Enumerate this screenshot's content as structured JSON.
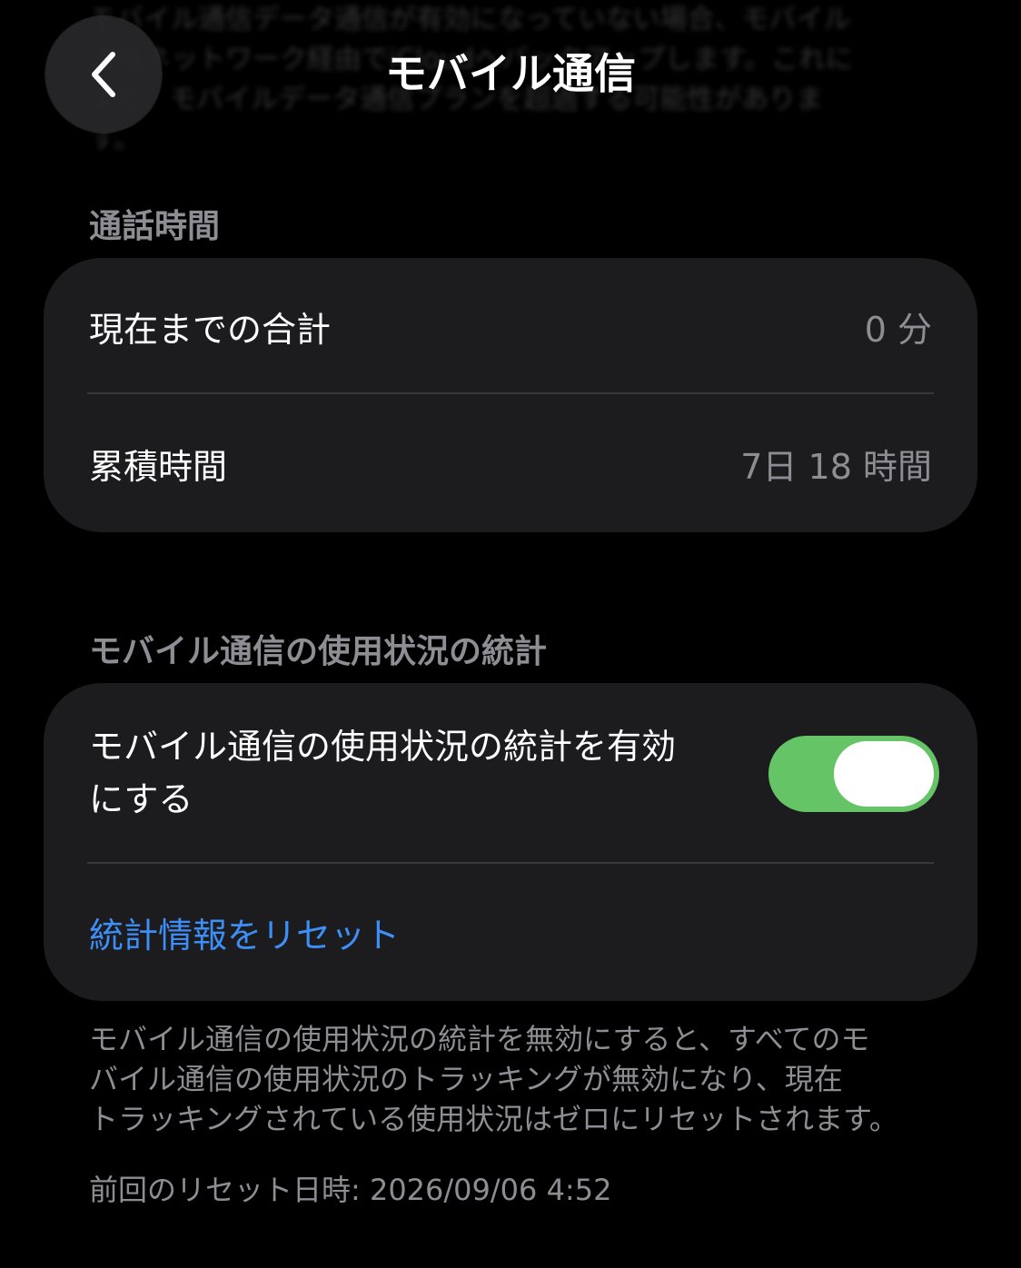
{
  "background_text": "モバイル通信データ通信が有効になっていない場合、モバイル通信ネットワーク経由でiCloudへバックアップします。これにより、モバイルデータ通信プランを超過する可能性があります。",
  "nav": {
    "title": "モバイル通信",
    "back_icon": "chevron-left-icon"
  },
  "call_time": {
    "header": "通話時間",
    "rows": [
      {
        "label": "現在までの合計",
        "value": "0 分"
      },
      {
        "label": "累積時間",
        "value": "7日 18 時間"
      }
    ]
  },
  "usage_stats": {
    "header": "モバイル通信の使用状況の統計",
    "toggle_label_line1": "モバイル通信の使用状況の統計を有効",
    "toggle_label_line2": "にする",
    "toggle_on": true,
    "reset_label": "統計情報をリセット",
    "footer_line1": "モバイル通信の使用状況の統計を無効にすると、すべてのモ",
    "footer_line2": "バイル通信の使用状況のトラッキングが無効になり、現在",
    "footer_line3": "トラッキングされている使用状況はゼロにリセットされます。",
    "last_reset": "前回のリセット日時: 2026/09/06 4:52"
  },
  "colors": {
    "accent_link": "#3e8ef7",
    "toggle_on": "#65c466",
    "card_bg": "#1c1c1e",
    "secondary_text": "#8d8d93"
  }
}
